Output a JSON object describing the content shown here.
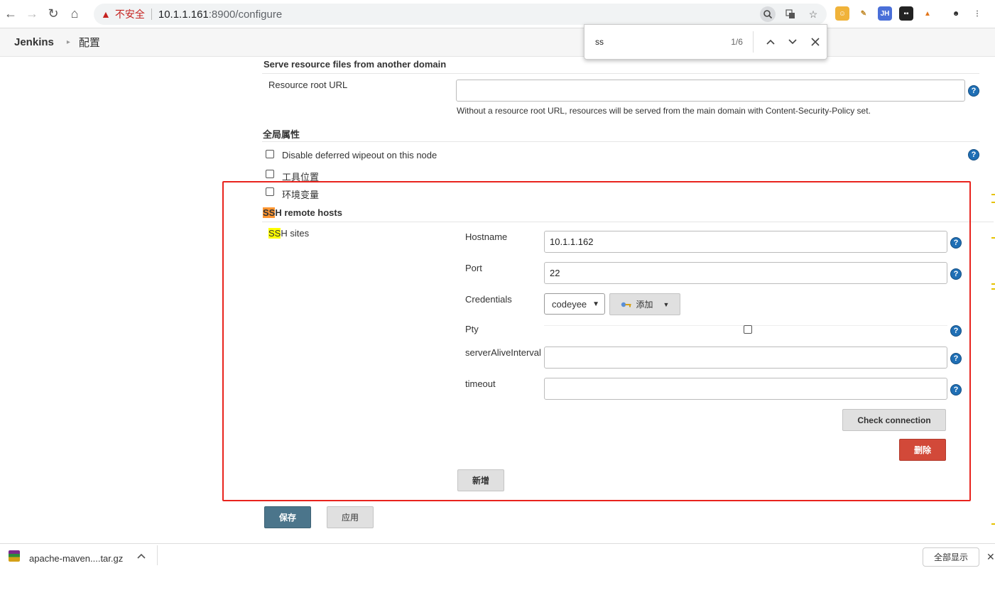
{
  "browser": {
    "back_icon": "←",
    "forward_icon": "→",
    "reload_icon": "↻",
    "home_icon": "⌂",
    "insecure_label": "不安全",
    "url_host": "10.1.1.161",
    "url_rest": ":8900/configure"
  },
  "header": {
    "brand": "Jenkins",
    "crumb": "配置"
  },
  "find": {
    "query": "ss",
    "count": "1/6"
  },
  "resource": {
    "section_title": "Serve resource files from another domain",
    "label": "Resource root URL",
    "value": "",
    "hint": "Without a resource root URL, resources will be served from the main domain with Content-Security-Policy set."
  },
  "global": {
    "section_title": "全局属性",
    "options": [
      "Disable deferred wipeout on this node",
      "工具位置",
      "环境变量"
    ]
  },
  "ssh": {
    "title_hl": "SS",
    "title_rest": "H remote hosts",
    "sites_hl": "SS",
    "sites_rest": "H sites",
    "hostname_label": "Hostname",
    "hostname_value": "10.1.1.162",
    "port_label": "Port",
    "port_value": "22",
    "credentials_label": "Credentials",
    "credentials_value": "codeyee",
    "add_label": "添加",
    "pty_label": "Pty",
    "alive_label": "serverAliveInterval",
    "alive_value": "",
    "timeout_label": "timeout",
    "timeout_value": "",
    "check_label": "Check connection",
    "delete_label": "删除",
    "new_label": "新增"
  },
  "actions": {
    "save_label": "保存",
    "apply_label": "应用"
  },
  "download": {
    "filename": "apache-maven....tar.gz",
    "show_all": "全部显示"
  },
  "colors": {
    "highlight": "#ffff00",
    "highlight_active": "#ff9632",
    "annotation_frame": "#e8231d",
    "save_button": "#4b758b",
    "delete_button": "#d24939",
    "help_icon": "#1f6fb5"
  }
}
